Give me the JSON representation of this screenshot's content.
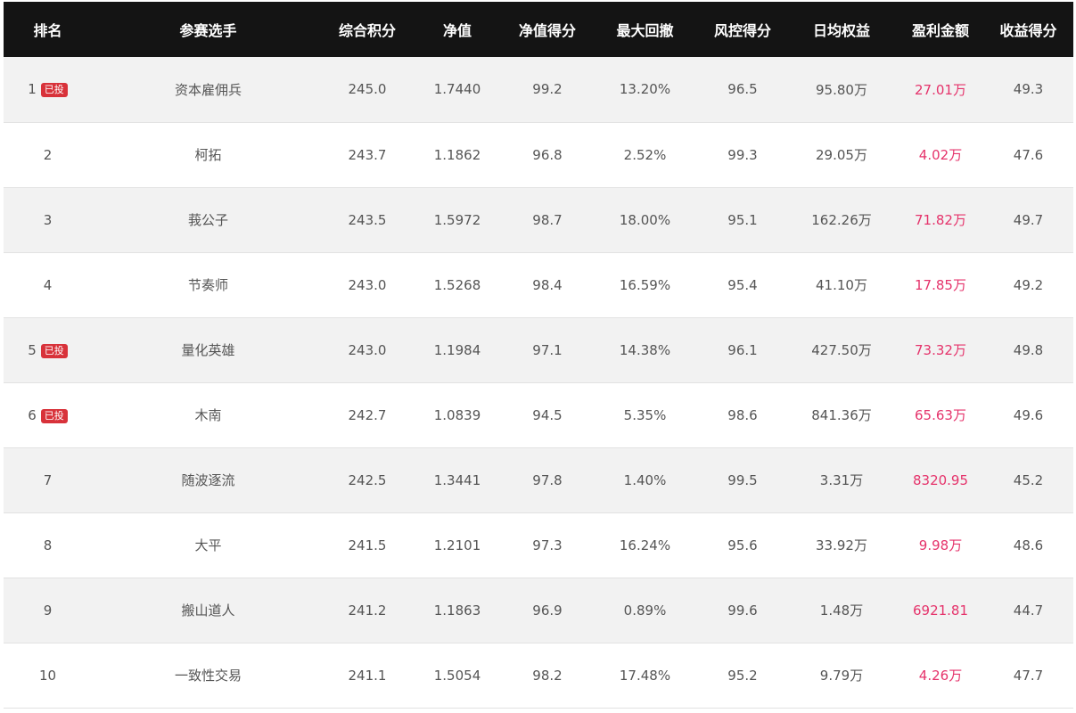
{
  "header": {
    "columns": [
      "排名",
      "参赛选手",
      "综合积分",
      "净值",
      "净值得分",
      "最大回撤",
      "风控得分",
      "日均权益",
      "盈利金额",
      "收益得分"
    ]
  },
  "badge_label": "已投",
  "colors": {
    "header_bg": "#141414",
    "row_odd_bg": "#f2f2f2",
    "row_even_bg": "#ffffff",
    "profit_text": "#e5336b",
    "badge_bg": "#d8323a"
  },
  "rows": [
    {
      "rank": "1",
      "invested": true,
      "name": "资本雇佣兵",
      "score": "245.0",
      "nav": "1.7440",
      "nav_score": "99.2",
      "max_drawdown": "13.20%",
      "risk_score": "96.5",
      "avg_equity": "95.80万",
      "profit": "27.01万",
      "return_score": "49.3"
    },
    {
      "rank": "2",
      "invested": false,
      "name": "柯拓",
      "score": "243.7",
      "nav": "1.1862",
      "nav_score": "96.8",
      "max_drawdown": "2.52%",
      "risk_score": "99.3",
      "avg_equity": "29.05万",
      "profit": "4.02万",
      "return_score": "47.6"
    },
    {
      "rank": "3",
      "invested": false,
      "name": "莪公子",
      "score": "243.5",
      "nav": "1.5972",
      "nav_score": "98.7",
      "max_drawdown": "18.00%",
      "risk_score": "95.1",
      "avg_equity": "162.26万",
      "profit": "71.82万",
      "return_score": "49.7"
    },
    {
      "rank": "4",
      "invested": false,
      "name": "节奏师",
      "score": "243.0",
      "nav": "1.5268",
      "nav_score": "98.4",
      "max_drawdown": "16.59%",
      "risk_score": "95.4",
      "avg_equity": "41.10万",
      "profit": "17.85万",
      "return_score": "49.2"
    },
    {
      "rank": "5",
      "invested": true,
      "name": "量化英雄",
      "score": "243.0",
      "nav": "1.1984",
      "nav_score": "97.1",
      "max_drawdown": "14.38%",
      "risk_score": "96.1",
      "avg_equity": "427.50万",
      "profit": "73.32万",
      "return_score": "49.8"
    },
    {
      "rank": "6",
      "invested": true,
      "name": "木南",
      "score": "242.7",
      "nav": "1.0839",
      "nav_score": "94.5",
      "max_drawdown": "5.35%",
      "risk_score": "98.6",
      "avg_equity": "841.36万",
      "profit": "65.63万",
      "return_score": "49.6"
    },
    {
      "rank": "7",
      "invested": false,
      "name": "随波逐流",
      "score": "242.5",
      "nav": "1.3441",
      "nav_score": "97.8",
      "max_drawdown": "1.40%",
      "risk_score": "99.5",
      "avg_equity": "3.31万",
      "profit": "8320.95",
      "return_score": "45.2"
    },
    {
      "rank": "8",
      "invested": false,
      "name": "大平",
      "score": "241.5",
      "nav": "1.2101",
      "nav_score": "97.3",
      "max_drawdown": "16.24%",
      "risk_score": "95.6",
      "avg_equity": "33.92万",
      "profit": "9.98万",
      "return_score": "48.6"
    },
    {
      "rank": "9",
      "invested": false,
      "name": "搬山道人",
      "score": "241.2",
      "nav": "1.1863",
      "nav_score": "96.9",
      "max_drawdown": "0.89%",
      "risk_score": "99.6",
      "avg_equity": "1.48万",
      "profit": "6921.81",
      "return_score": "44.7"
    },
    {
      "rank": "10",
      "invested": false,
      "name": "一致性交易",
      "score": "241.1",
      "nav": "1.5054",
      "nav_score": "98.2",
      "max_drawdown": "17.48%",
      "risk_score": "95.2",
      "avg_equity": "9.79万",
      "profit": "4.26万",
      "return_score": "47.7"
    }
  ]
}
